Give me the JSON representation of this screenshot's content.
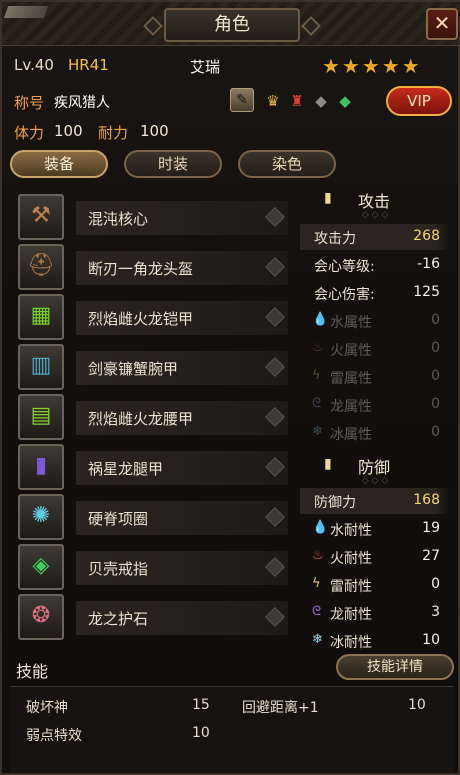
{
  "window": {
    "title": "角色",
    "close_icon": "close-icon"
  },
  "header": {
    "level": "Lv.40",
    "hr": "HR41",
    "name": "艾瑞",
    "stars": "★★★★★",
    "title_label": "称号",
    "title_value": "疾风猎人",
    "vip_label": "VIP",
    "stamina_label": "体力",
    "stamina_value": "100",
    "endurance_label": "耐力",
    "endurance_value": "100"
  },
  "tabs": [
    {
      "label": "装备",
      "active": true
    },
    {
      "label": "时装",
      "active": false
    },
    {
      "label": "染色",
      "active": false
    }
  ],
  "equipment": [
    {
      "name": "混沌核心",
      "icon": "axe-icon"
    },
    {
      "name": "断刃一角龙头盔",
      "icon": "helmet-icon"
    },
    {
      "name": "烈焰雌火龙铠甲",
      "icon": "chest-armor-icon"
    },
    {
      "name": "剑豪镰蟹腕甲",
      "icon": "gauntlet-icon"
    },
    {
      "name": "烈焰雌火龙腰甲",
      "icon": "waist-armor-icon"
    },
    {
      "name": "祸星龙腿甲",
      "icon": "leg-armor-icon"
    },
    {
      "name": "硬脊项圈",
      "icon": "necklace-icon"
    },
    {
      "name": "贝壳戒指",
      "icon": "ring-icon"
    },
    {
      "name": "龙之护石",
      "icon": "talisman-icon"
    }
  ],
  "attack": {
    "title": "攻击",
    "stats": [
      {
        "label": "攻击力",
        "value": "268"
      },
      {
        "label": "会心等级:",
        "value": "-16"
      },
      {
        "label": "会心伤害:",
        "value": "125"
      }
    ],
    "elements": [
      {
        "label": "水属性",
        "value": "0",
        "icon": "water-icon"
      },
      {
        "label": "火属性",
        "value": "0",
        "icon": "fire-icon"
      },
      {
        "label": "雷属性",
        "value": "0",
        "icon": "thunder-icon"
      },
      {
        "label": "龙属性",
        "value": "0",
        "icon": "dragon-icon"
      },
      {
        "label": "冰属性",
        "value": "0",
        "icon": "ice-icon"
      }
    ]
  },
  "defense": {
    "title": "防御",
    "stats": [
      {
        "label": "防御力",
        "value": "168"
      }
    ],
    "resists": [
      {
        "label": "水耐性",
        "value": "19",
        "icon": "water-icon"
      },
      {
        "label": "火耐性",
        "value": "27",
        "icon": "fire-icon"
      },
      {
        "label": "雷耐性",
        "value": "0",
        "icon": "thunder-icon"
      },
      {
        "label": "龙耐性",
        "value": "3",
        "icon": "dragon-icon"
      },
      {
        "label": "冰耐性",
        "value": "10",
        "icon": "ice-icon"
      }
    ]
  },
  "skills": {
    "title": "技能",
    "details_button": "技能详情",
    "list": [
      {
        "name": "破坏神",
        "value": "15"
      },
      {
        "name": "回避距离+1",
        "value": "10"
      },
      {
        "name": "弱点特效",
        "value": "10"
      }
    ]
  },
  "colors": {
    "accent_gold": "#f5d46e",
    "label_orange": "#f0a04a",
    "vip_red": "#c62b1c"
  }
}
